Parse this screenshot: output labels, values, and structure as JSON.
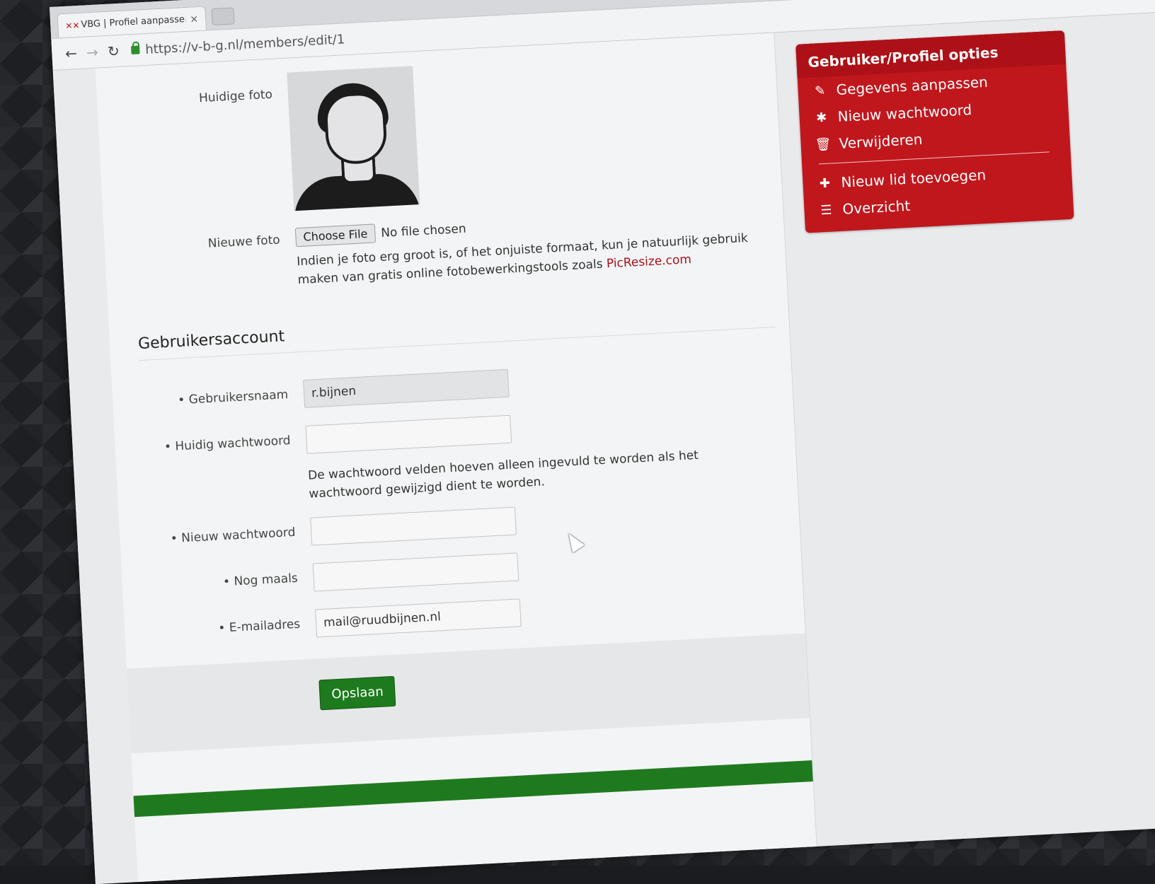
{
  "browser": {
    "tab_title": "VBG | Profiel aanpassen",
    "tab_close": "×",
    "url": "https://v-b-g.nl/members/edit/1"
  },
  "photo": {
    "current_label": "Huidige foto",
    "new_label": "Nieuwe foto",
    "choose_file_label": "Choose File",
    "file_status": "No file chosen",
    "help_text": "Indien je foto erg groot is, of het onjuiste formaat, kun je natuurlijk gebruik maken van gratis online fotobewerkingstools zoals ",
    "help_link": "PicResize.com"
  },
  "account": {
    "section_title": "Gebruikersaccount",
    "username_label": "Gebruikersnaam",
    "username_value": "r.bijnen",
    "current_password_label": "Huidig wachtwoord",
    "password_help": "De wachtwoord velden hoeven alleen ingevuld te worden als het wachtwoord gewijzigd dient te worden.",
    "new_password_label": "Nieuw wachtwoord",
    "repeat_label": "Nog maals",
    "email_label": "E-mailadres",
    "email_value": "mail@ruudbijnen.nl"
  },
  "actions": {
    "save_label": "Opslaan"
  },
  "options": {
    "title": "Gebruiker/Profiel opties",
    "items": [
      {
        "label": "Gegevens aanpassen",
        "icon": "pencil-icon"
      },
      {
        "label": "Nieuw wachtwoord",
        "icon": "asterisk-icon"
      },
      {
        "label": "Verwijderen",
        "icon": "trash-icon"
      },
      {
        "label": "Nieuw lid toevoegen",
        "icon": "plus-icon"
      },
      {
        "label": "Overzicht",
        "icon": "list-icon"
      }
    ],
    "accent": "#c0171d"
  }
}
